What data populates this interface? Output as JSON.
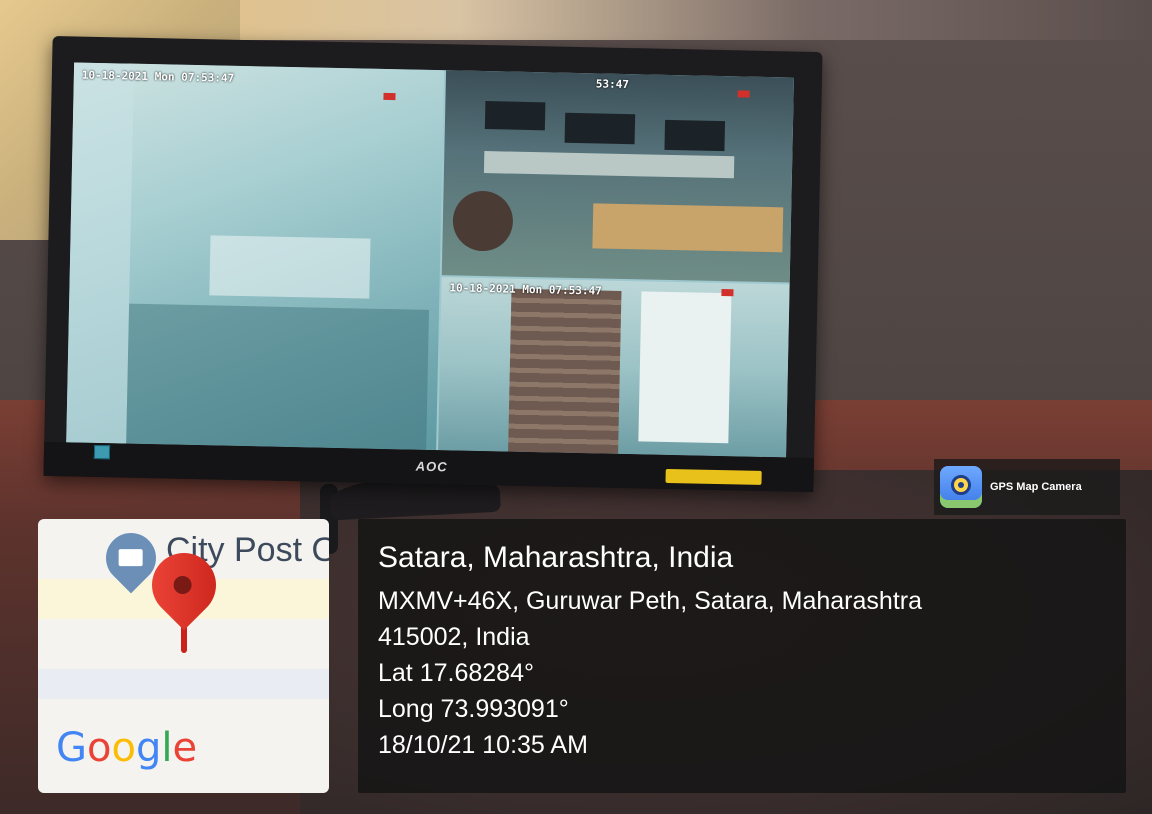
{
  "monitor": {
    "brand": "AOC",
    "osd": {
      "cam1_datetime": "10-18-2021 Mon 07:53:47",
      "cam2_time": "53:47",
      "cam3_datetime": "10-18-2021 Mon 07:53:47"
    }
  },
  "gps_badge": {
    "app_name": "GPS Map Camera",
    "icon": "gps-map-camera-app-icon"
  },
  "map": {
    "place_label": "City Post O",
    "logo_letters": [
      {
        "ch": "G",
        "color": "#4285F4"
      },
      {
        "ch": "o",
        "color": "#EA4335"
      },
      {
        "ch": "o",
        "color": "#FBBC05"
      },
      {
        "ch": "g",
        "color": "#4285F4"
      },
      {
        "ch": "l",
        "color": "#34A853"
      },
      {
        "ch": "e",
        "color": "#EA4335"
      }
    ],
    "pin_color": "#D93025",
    "mail_pin_color": "#6C8FB8"
  },
  "location": {
    "title": "Satara, Maharashtra, India",
    "address_line1": "MXMV+46X, Guruwar Peth, Satara, Maharashtra",
    "address_line2": "415002, India",
    "lat": "Lat 17.68284°",
    "long": "Long 73.993091°",
    "datetime": "18/10/21 10:35 AM"
  }
}
